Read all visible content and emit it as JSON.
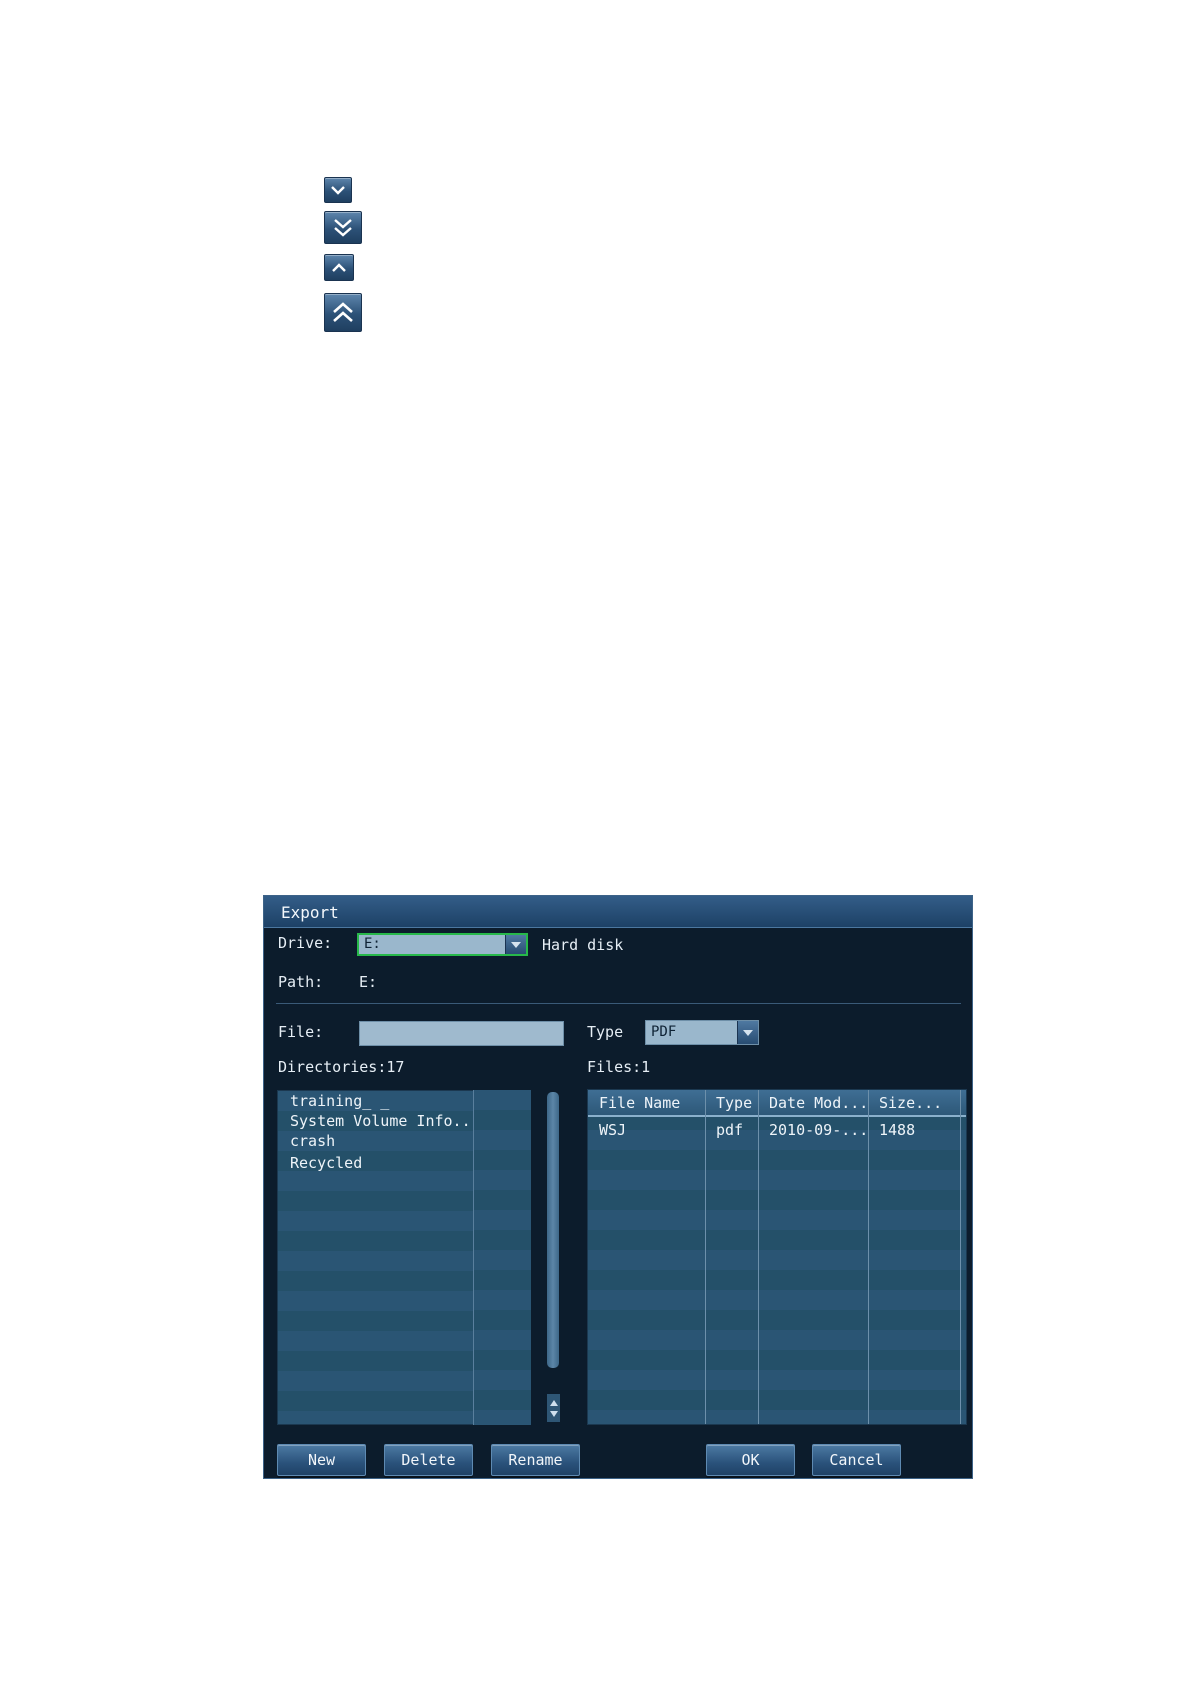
{
  "icons": [
    {
      "name": "scroll-down-icon"
    },
    {
      "name": "page-down-icon"
    },
    {
      "name": "scroll-up-icon"
    },
    {
      "name": "page-up-icon"
    }
  ],
  "dialog": {
    "title": "Export",
    "drive_label": "Drive:",
    "drive_value": "E:",
    "drive_desc": "Hard disk",
    "path_label": "Path:",
    "path_value": "E:",
    "file_label": "File:",
    "file_value": "",
    "type_label": "Type",
    "type_value": "PDF",
    "directories_label": "Directories:17",
    "files_label": "Files:1",
    "directories": [
      "training_ _",
      "System Volume Info...",
      "crash",
      "Recycled"
    ],
    "table": {
      "headers": [
        "File Name",
        "Type",
        "Date Mod...",
        "Size..."
      ],
      "rows": [
        [
          "WSJ",
          "pdf",
          "2010-09-...",
          "1488"
        ]
      ]
    },
    "buttons": {
      "new": "New",
      "delete": "Delete",
      "rename": "Rename",
      "ok": "OK",
      "cancel": "Cancel"
    }
  },
  "colors": {
    "dialog_bg": "#0c1c2c",
    "titlebar": "#2a527b",
    "list_row": "#2a5574",
    "drive_focus": "#27b84a"
  }
}
